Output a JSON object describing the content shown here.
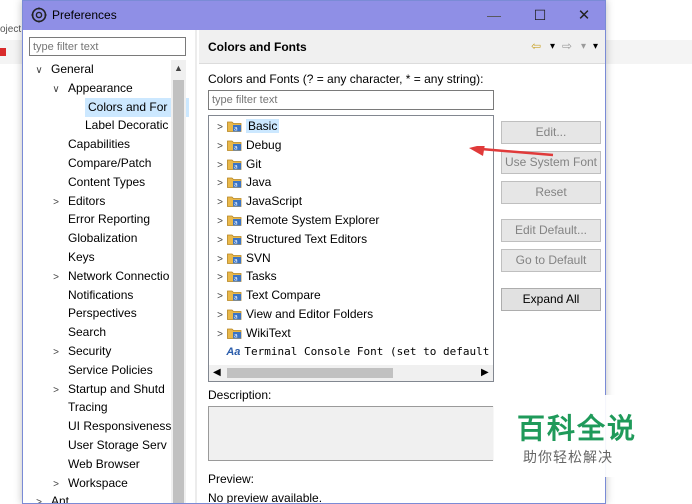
{
  "background": {
    "project_label": "oject"
  },
  "window": {
    "title": "Preferences",
    "minimize": "—",
    "maximize": "☐",
    "close": "✕"
  },
  "left": {
    "filter_placeholder": "type filter text",
    "tree": [
      {
        "label": "General",
        "toggle": "∨",
        "indent": 0
      },
      {
        "label": "Appearance",
        "toggle": "∨",
        "indent": 1
      },
      {
        "label": "Colors and For",
        "toggle": "",
        "indent": 2,
        "selected": true
      },
      {
        "label": "Label Decoratic",
        "toggle": "",
        "indent": 2
      },
      {
        "label": "Capabilities",
        "toggle": "",
        "indent": 1
      },
      {
        "label": "Compare/Patch",
        "toggle": "",
        "indent": 1
      },
      {
        "label": "Content Types",
        "toggle": "",
        "indent": 1
      },
      {
        "label": "Editors",
        "toggle": ">",
        "indent": 1
      },
      {
        "label": "Error Reporting",
        "toggle": "",
        "indent": 1
      },
      {
        "label": "Globalization",
        "toggle": "",
        "indent": 1
      },
      {
        "label": "Keys",
        "toggle": "",
        "indent": 1
      },
      {
        "label": "Network Connectio",
        "toggle": ">",
        "indent": 1
      },
      {
        "label": "Notifications",
        "toggle": "",
        "indent": 1
      },
      {
        "label": "Perspectives",
        "toggle": "",
        "indent": 1
      },
      {
        "label": "Search",
        "toggle": "",
        "indent": 1
      },
      {
        "label": "Security",
        "toggle": ">",
        "indent": 1
      },
      {
        "label": "Service Policies",
        "toggle": "",
        "indent": 1
      },
      {
        "label": "Startup and Shutd",
        "toggle": ">",
        "indent": 1
      },
      {
        "label": "Tracing",
        "toggle": "",
        "indent": 1
      },
      {
        "label": "UI Responsiveness",
        "toggle": "",
        "indent": 1
      },
      {
        "label": "User Storage Serv",
        "toggle": "",
        "indent": 1
      },
      {
        "label": "Web Browser",
        "toggle": "",
        "indent": 1
      },
      {
        "label": "Workspace",
        "toggle": ">",
        "indent": 1
      },
      {
        "label": "Ant",
        "toggle": ">",
        "indent": 0
      }
    ]
  },
  "right": {
    "title": "Colors and Fonts",
    "nav": {
      "back": "⇦",
      "back_menu": "▾",
      "forward": "⇨",
      "forward_menu": "▾",
      "view_menu": "▾"
    },
    "description": "Colors and Fonts (? = any character, * = any string):",
    "filter_placeholder": "type filter text",
    "categories": [
      {
        "label": "Basic",
        "selected": true
      },
      {
        "label": "Debug"
      },
      {
        "label": "Git"
      },
      {
        "label": "Java"
      },
      {
        "label": "JavaScript"
      },
      {
        "label": "Remote System Explorer"
      },
      {
        "label": "Structured Text Editors"
      },
      {
        "label": "SVN"
      },
      {
        "label": "Tasks"
      },
      {
        "label": "Text Compare"
      },
      {
        "label": "View and Editor Folders"
      },
      {
        "label": "WikiText"
      }
    ],
    "font_item": {
      "prefix": "Aa",
      "label": "Terminal Console Font (set to default"
    },
    "buttons": {
      "edit": "Edit...",
      "use_system_font": "Use System Font",
      "reset": "Reset",
      "edit_default": "Edit Default...",
      "go_to_default": "Go to Default",
      "expand_all": "Expand All"
    },
    "description_label": "Description:",
    "preview_label": "Preview:",
    "preview_text": "No preview available."
  },
  "watermark": {
    "title": "百科全说",
    "subtitle": "助你轻松解决"
  },
  "colors": {
    "titlebar": "#8f8fe6",
    "selection": "#cce8ff",
    "arrow": "#e03a3a",
    "watermark": "#1f9a5a"
  }
}
